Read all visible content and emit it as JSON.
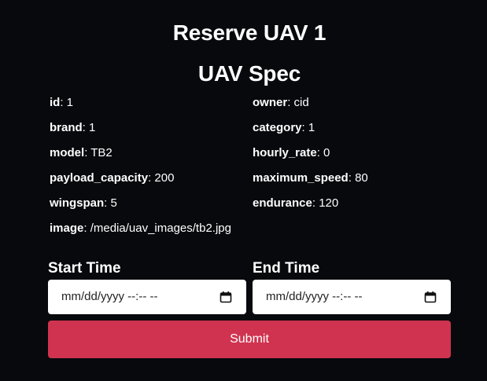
{
  "page": {
    "title": "Reserve UAV 1",
    "spec_heading": "UAV Spec"
  },
  "spec": {
    "id": {
      "label": "id",
      "value": ": 1"
    },
    "owner": {
      "label": "owner",
      "value": ": cid"
    },
    "brand": {
      "label": "brand",
      "value": ": 1"
    },
    "category": {
      "label": "category",
      "value": ": 1"
    },
    "model": {
      "label": "model",
      "value": ": TB2"
    },
    "hourly_rate": {
      "label": "hourly_rate",
      "value": ": 0"
    },
    "payload_capacity": {
      "label": "payload_capacity",
      "value": ": 200"
    },
    "maximum_speed": {
      "label": "maximum_speed",
      "value": ": 80"
    },
    "wingspan": {
      "label": "wingspan",
      "value": ": 5"
    },
    "endurance": {
      "label": "endurance",
      "value": ": 120"
    },
    "image": {
      "label": "image",
      "value": ": /media/uav_images/tb2.jpg"
    }
  },
  "form": {
    "start_label": "Start Time",
    "end_label": "End Time",
    "start_placeholder": "mm/dd/yyyy --:-- --",
    "end_placeholder": "mm/dd/yyyy --:-- --",
    "submit_label": "Submit"
  },
  "colors": {
    "background": "#07090d",
    "submit": "#d0334f"
  },
  "icons": {
    "calendar": "calendar-icon"
  }
}
